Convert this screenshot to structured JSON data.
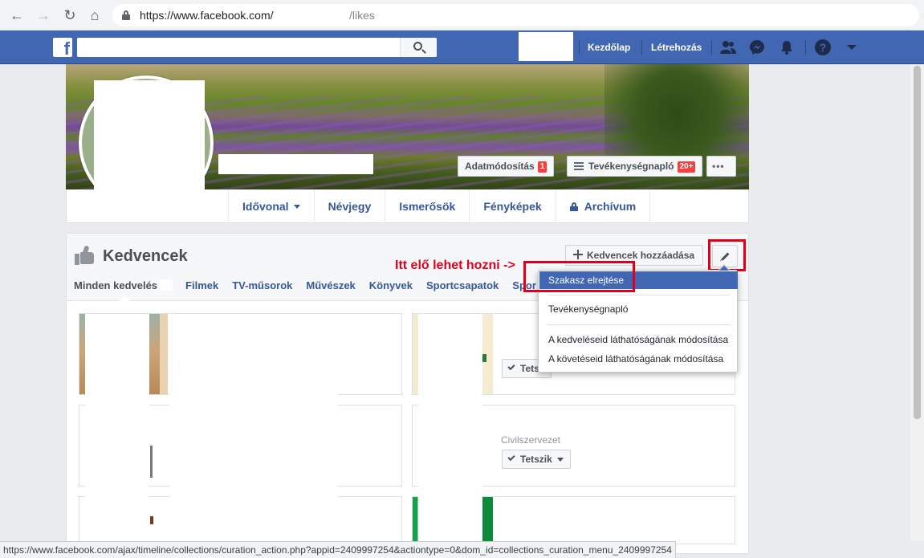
{
  "browser": {
    "url_host": "https://www.facebook.com/",
    "url_path": "/likes",
    "status_url": "https://www.facebook.com/ajax/timeline/collections/curation_action.php?appid=2409997254&actiontype=0&dom_id=collections_curation_menu_2409997254"
  },
  "fb_bar": {
    "logo": "f",
    "home": "Kezdőlap",
    "create": "Létrehozás"
  },
  "cover": {
    "edit_info": "Adatmódosítás",
    "edit_info_badge": "1",
    "activity_log": "Tevékenységnapló",
    "activity_badge": "20+",
    "more": "•••"
  },
  "tabs": [
    {
      "label": "Idővonal"
    },
    {
      "label": "Névjegy"
    },
    {
      "label": "Ismerősök"
    },
    {
      "label": "Fényképek"
    },
    {
      "label": "Archívum"
    }
  ],
  "favorites": {
    "title": "Kedvencek",
    "add_button": "Kedvencek hozzáadása",
    "annotation": "Itt elő lehet hozni ->",
    "subtabs": [
      "Minden kedvelés",
      "Filmek",
      "TV-műsorok",
      "Művészek",
      "Könyvek",
      "Sportcsapatok",
      "Spor"
    ],
    "items": [
      {
        "like_label": "Tetsz"
      },
      {
        "category": "Civilszervezet",
        "like_label": "Tetszik"
      }
    ]
  },
  "dropdown": {
    "items": [
      "Szakasz elrejtése",
      "Tevékenységnapló",
      "A kedveléseid láthatóságának módosítása",
      "A követéseid láthatóságának módosítása"
    ]
  },
  "colors": {
    "fb_blue": "#4267b2",
    "annotation_red": "#e0001b",
    "link_blue": "#365899"
  }
}
